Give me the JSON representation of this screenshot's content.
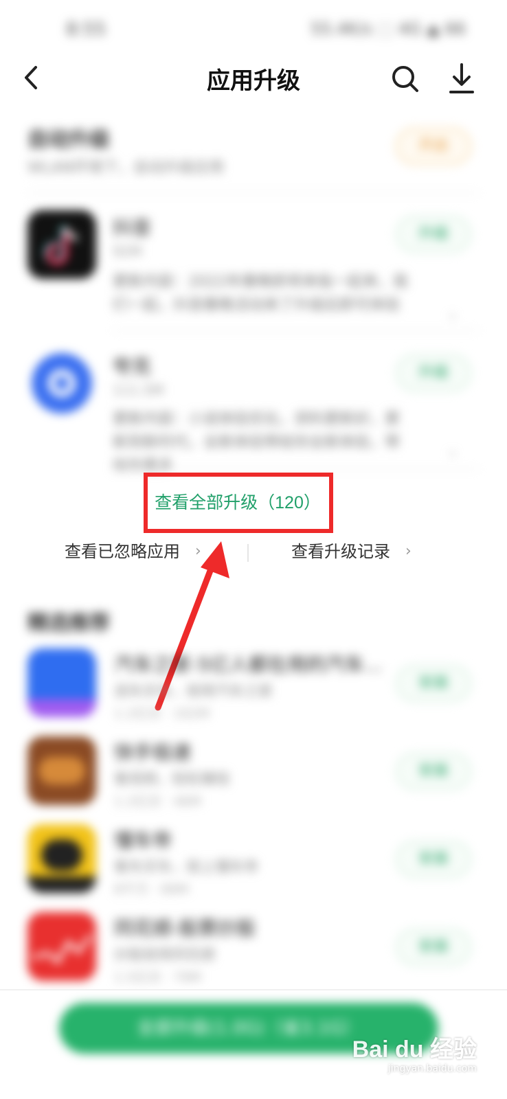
{
  "status_bar": {
    "time": "8:55",
    "icons_text": "55.4K/s ⬚ 4G ▲ 66"
  },
  "header": {
    "title": "应用升级",
    "back_icon": "chevron-left-icon",
    "search_icon": "search-icon",
    "download_icon": "download-icon"
  },
  "auto_upgrade": {
    "title": "自动升级",
    "description": "WLAN环境下，自动升级应用",
    "button_label": "开启"
  },
  "upgrade_list": [
    {
      "name": "抖音",
      "size": "92M",
      "notes": "更新内容：2022年春晚即将来临一起来，我们一起，抖音春晚活动来了升级后即可体验",
      "button_label": "升级",
      "icon_color": "#111111"
    },
    {
      "name": "夸克",
      "size": "111.5M",
      "notes": "更新内容：小说体验优化，资料更新好，更新到新时代，全新体验带给你全新体验，带给你更多",
      "button_label": "升级",
      "icon_color": "#3a6ff0"
    }
  ],
  "links": {
    "view_all": "查看全部升级（120）",
    "ignored_apps": "查看已忽略应用",
    "history": "查看升级记录"
  },
  "recommended": {
    "title": "精选推荐",
    "items": [
      {
        "name": "汽车之家-5亿人都在用的汽车...",
        "desc": "选车买车，就用汽车之家",
        "meta": "1.2亿次 · 102M",
        "button_label": "安装",
        "icon_color": "#2f6df0"
      },
      {
        "name": "快手极速",
        "desc": "看视频，轻松赚钱",
        "meta": "1.2亿次 · 46M",
        "button_label": "安装",
        "icon_color": "#8a4a24"
      },
      {
        "name": "懂车帝",
        "desc": "看车买车，就上懂车帝",
        "meta": "8千万 · 89M",
        "button_label": "安装",
        "icon_color": "#f2c319"
      },
      {
        "name": "同花顺-股票炒股",
        "desc": "炒股就用同花顺",
        "meta": "1.5亿次 · 79M",
        "button_label": "安装",
        "icon_color": "#e8302f"
      }
    ]
  },
  "bottom": {
    "upgrade_all_label": "全部升级(1.0G)（省3.1G）"
  },
  "watermark": {
    "brand": "Bai du 经验",
    "url": "jingyan.baidu.com"
  },
  "colors": {
    "accent_green": "#21a06a",
    "highlight_red": "#ee2a2a",
    "button_green": "#27b26b"
  }
}
